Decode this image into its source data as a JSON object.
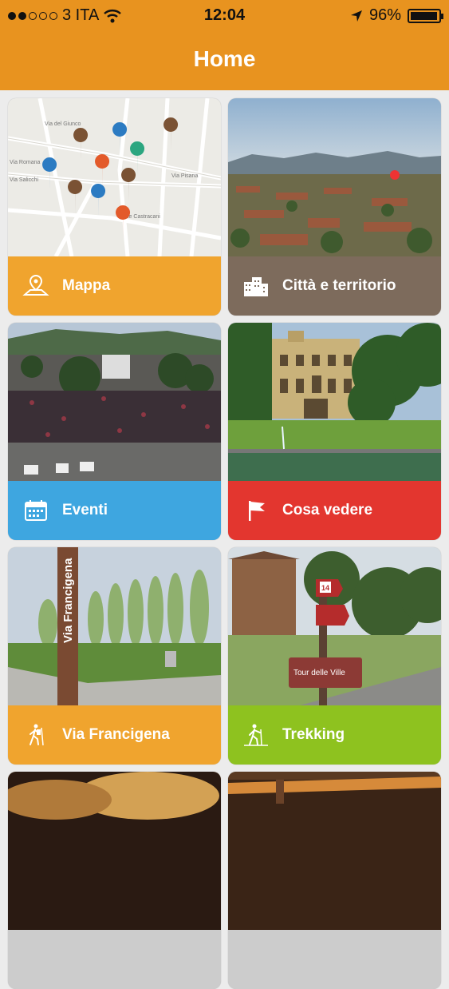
{
  "status_bar": {
    "carrier": "3 ITA",
    "time": "12:04",
    "battery": "96%"
  },
  "header": {
    "title": "Home"
  },
  "tiles": [
    {
      "label": "Mappa",
      "color": "#f0a42e",
      "icon": "map-icon"
    },
    {
      "label": "Città e territorio",
      "color": "#7d6b5c",
      "icon": "buildings-icon"
    },
    {
      "label": "Eventi",
      "color": "#3ea6e0",
      "icon": "calendar-icon"
    },
    {
      "label": "Cosa vedere",
      "color": "#e3362f",
      "icon": "flag-icon"
    },
    {
      "label": "Via Francigena",
      "color": "#f0a42e",
      "icon": "hiker-icon"
    },
    {
      "label": "Trekking",
      "color": "#8ec21f",
      "icon": "trekker-icon"
    }
  ],
  "map_labels": {
    "street_1": "Via del Giunco",
    "street_2": "Via Romana",
    "street_3": "Via Salicchi",
    "street_4": "Via Pisana",
    "street_5": "Viale Castracani"
  },
  "signpost": {
    "number": "14",
    "text": "Tour delle Ville"
  },
  "banner_text": "Via Francigena"
}
